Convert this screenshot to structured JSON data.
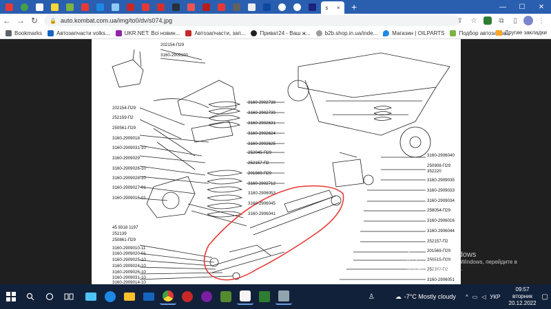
{
  "browser": {
    "active_tab_label": "s",
    "active_tab_close": "×",
    "new_tab": "+",
    "window_controls": [
      "—",
      "☐",
      "✕"
    ],
    "url": "auto.kombat.com.ua/img/to0/dv/s074.jpg"
  },
  "bookmarks": {
    "items": [
      {
        "label": "Bookmarks",
        "color": "#5f6368"
      },
      {
        "label": "Автозапчасти volks...",
        "color": "#1565c0"
      },
      {
        "label": "UKR.NET: Всі новин...",
        "color": "#8e24aa"
      },
      {
        "label": "Автозапчасти, зап...",
        "color": "#c62828"
      },
      {
        "label": "Приват24 - Ваш ж...",
        "color": "#212121"
      },
      {
        "label": "b2b.shop.in.ua/inde...",
        "color": "#9e9e9e"
      },
      {
        "label": "Магазин | OILPARTS",
        "color": "#1e88e5"
      },
      {
        "label": "Подбор автозапча...",
        "color": "#7cb342"
      }
    ],
    "other_label": "Другие закладки"
  },
  "diagram": {
    "labels_left": [
      "202154-П29",
      "3160-2909100",
      "202154-П29",
      "252159-П2",
      "250561-П29",
      "3160-2909018",
      "3160-2909031-10",
      "3160-2909029",
      "3160-2909026-10",
      "3160-2909028-10",
      "3160-2909027-01",
      "3160-2909016-01",
      "45 9318 1197",
      "252139",
      "250861-П29",
      "3160-2909010-11",
      "3160-2909020-01",
      "3160-2909025-10",
      "3160-2909024-10",
      "3160-2909026-10",
      "3160-2909031-10",
      "3160-2909014-10"
    ],
    "labels_center": [
      "3160-2902738",
      "3160-2902739",
      "3160-2902631",
      "3160-2902624",
      "3160-2902625",
      "252045-П29",
      "252157-П2",
      "201569-П29",
      "3160-2902712",
      "3160-2906053",
      "3160-2906045",
      "3160-2906041"
    ],
    "labels_right": [
      "3160-2906040",
      "250908-П29",
      "352220",
      "3160-2909035",
      "3160-2909033",
      "3160-2909034",
      "258054-П29",
      "3160-2906016",
      "3160-2906044",
      "252157-П2",
      "201569-П29",
      "250515-П29",
      "252157-П2",
      "3160-2906051"
    ]
  },
  "watermark": {
    "line1": "Активация Windows",
    "line2": "Чтобы активировать Windows, перейдите в",
    "line3": "раздел «Параметры»."
  },
  "taskbar": {
    "weather_text": "-7°C  Mostly cloudy",
    "tray_items": [
      "^",
      "ENG-icon",
      "УКР"
    ],
    "lang": "УКР",
    "time": "09:57",
    "weekday": "вторник",
    "date": "20.12.2022"
  },
  "colors": {
    "tabstrip": "#2a5fb0",
    "taskbar": "#12213a",
    "highlight": "#e53935"
  }
}
